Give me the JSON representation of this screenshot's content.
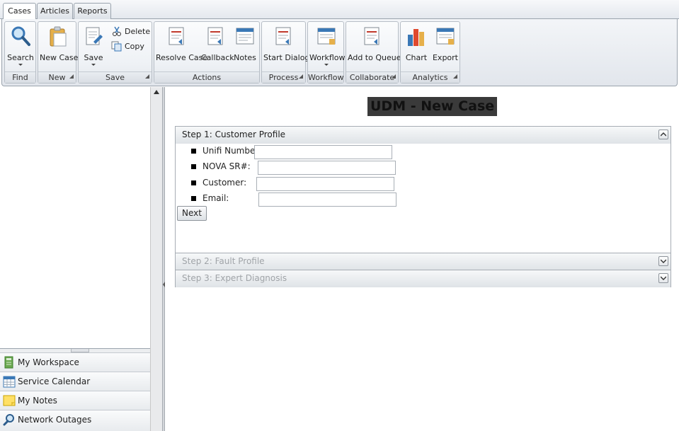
{
  "tabs": [
    "Cases",
    "Articles",
    "Reports"
  ],
  "ribbon": {
    "groups": {
      "find": "Find",
      "new": "New",
      "save": "Save",
      "actions": "Actions",
      "process": "Process",
      "workflow": "Workflow",
      "collaborate": "Collaborate",
      "analytics": "Analytics"
    },
    "buttons": {
      "search": "Search",
      "new_case": "New Case",
      "save": "Save",
      "delete": "Delete",
      "copy": "Copy",
      "resolve_case": "Resolve Case",
      "callback": "Callback",
      "notes": "Notes",
      "start_dialog": "Start Dialog",
      "workflow": "Workflow",
      "add_to_queue": "Add to Queue",
      "chart": "Chart",
      "export": "Export"
    }
  },
  "nav": {
    "items": [
      "My Workspace",
      "Service Calendar",
      "My Notes",
      "Network Outages"
    ]
  },
  "form": {
    "title": "UDM - New Case",
    "sections": [
      {
        "title": "Step 1: Customer Profile"
      },
      {
        "title": "Step 2: Fault Profile"
      },
      {
        "title": "Step 3: Expert Diagnosis"
      }
    ],
    "fields": [
      {
        "label": "Unifi Number:",
        "value": ""
      },
      {
        "label": "NOVA SR#:",
        "value": ""
      },
      {
        "label": "Customer:",
        "value": ""
      },
      {
        "label": "Email:",
        "value": ""
      }
    ],
    "next_label": "Next"
  },
  "colors": {
    "accent_border": "#9aa3ad",
    "title_redaction": "#3a3a3a"
  },
  "icons": [
    "search-icon",
    "new-case-icon",
    "save-icon",
    "delete-icon",
    "copy-icon",
    "resolve-case-icon",
    "callback-icon",
    "notes-icon",
    "start-dialog-icon",
    "workflow-icon",
    "add-to-queue-icon",
    "chart-icon",
    "export-icon",
    "workspace-icon",
    "calendar-icon",
    "notes-nav-icon",
    "network-outages-icon"
  ]
}
